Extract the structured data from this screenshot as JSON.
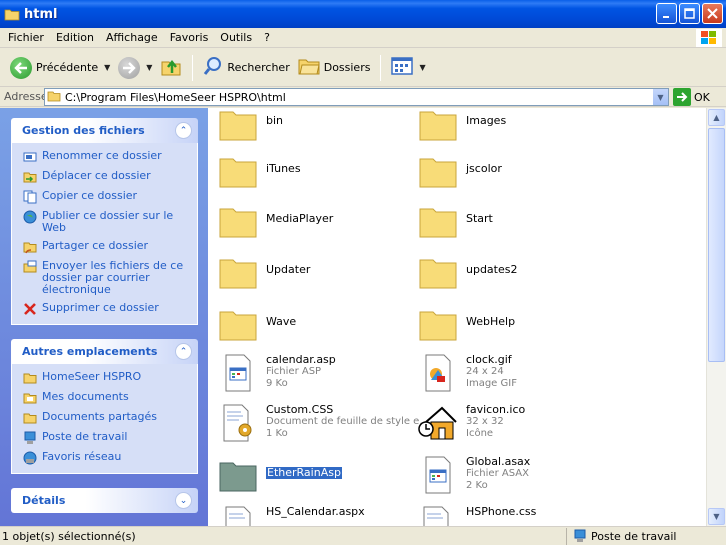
{
  "window": {
    "title": "html"
  },
  "menu": [
    "Fichier",
    "Edition",
    "Affichage",
    "Favoris",
    "Outils",
    "?"
  ],
  "toolbar": {
    "back_label": "Précédente",
    "search_label": "Rechercher",
    "folders_label": "Dossiers"
  },
  "address": {
    "label": "Adresse",
    "path": "C:\\Program Files\\HomeSeer HSPRO\\html",
    "go_label": "OK"
  },
  "tasks": {
    "file_tasks": {
      "title": "Gestion des fichiers",
      "items": [
        "Renommer ce dossier",
        "Déplacer ce dossier",
        "Copier ce dossier",
        "Publier ce dossier sur le Web",
        "Partager ce dossier",
        "Envoyer les fichiers de ce dossier par courrier électronique",
        "Supprimer ce dossier"
      ]
    },
    "other_places": {
      "title": "Autres emplacements",
      "items": [
        "HomeSeer HSPRO",
        "Mes documents",
        "Documents partagés",
        "Poste de travail",
        "Favoris réseau"
      ]
    },
    "details": {
      "title": "Détails"
    }
  },
  "files": [
    {
      "name": "bin",
      "type": "folder"
    },
    {
      "name": "Images",
      "type": "folder"
    },
    {
      "name": "iTunes",
      "type": "folder"
    },
    {
      "name": "jscolor",
      "type": "folder"
    },
    {
      "name": "MediaPlayer",
      "type": "folder"
    },
    {
      "name": "Start",
      "type": "folder"
    },
    {
      "name": "Updater",
      "type": "folder"
    },
    {
      "name": "updates2",
      "type": "folder"
    },
    {
      "name": "Wave",
      "type": "folder"
    },
    {
      "name": "WebHelp",
      "type": "folder"
    },
    {
      "name": "calendar.asp",
      "type": "asp",
      "line2": "Fichier ASP",
      "line3": "9 Ko"
    },
    {
      "name": "clock.gif",
      "type": "gif",
      "line2": "24 x 24",
      "line3": "Image GIF"
    },
    {
      "name": "Custom.CSS",
      "type": "css",
      "line2": "Document de feuille de style e...",
      "line3": "1 Ko"
    },
    {
      "name": "favicon.ico",
      "type": "ico",
      "line2": "32 x 32",
      "line3": "Icône"
    },
    {
      "name": "EtherRainAsp",
      "type": "folder-selected",
      "selected": true
    },
    {
      "name": "Global.asax",
      "type": "asax",
      "line2": "Fichier ASAX",
      "line3": "2 Ko"
    },
    {
      "name": "HS_Calendar.aspx",
      "type": "aspx"
    },
    {
      "name": "HSPhone.css",
      "type": "css2"
    }
  ],
  "status": {
    "left": "1 objet(s) sélectionné(s)",
    "right": "Poste de travail"
  },
  "colors": {
    "titlebar": "#0054E3",
    "taskpane_bg": "#6D8EE0",
    "link": "#215DC6",
    "selection": "#316AC5",
    "folder": "#F8DC78"
  }
}
